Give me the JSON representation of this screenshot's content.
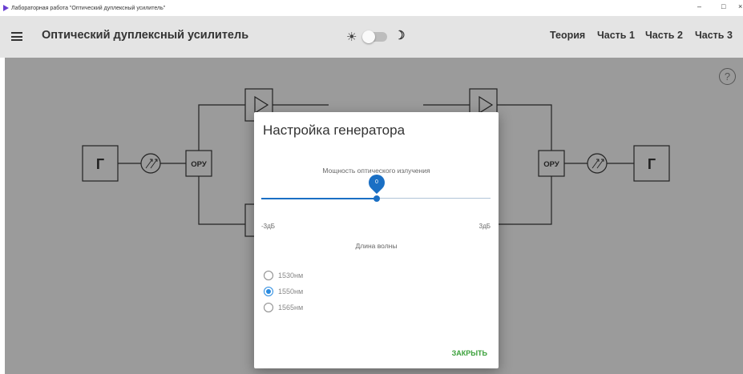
{
  "window": {
    "title": "Лабораторная работа \"Оптический дуплексный усилитель\"",
    "controls": {
      "minimize": "–",
      "maximize": "□",
      "close": "×"
    }
  },
  "appbar": {
    "menu_icon": "hamburger-menu-icon",
    "title": "Оптический дуплексный усилитель",
    "theme": {
      "sun_icon": "☀",
      "moon_icon": "☽",
      "dark_mode": false
    },
    "nav": [
      "Теория",
      "Часть 1",
      "Часть 2",
      "Часть 3"
    ]
  },
  "diagram": {
    "left_generator": "Г",
    "left_oru": "ОРУ",
    "right_oru": "ОРУ",
    "right_generator": "Г"
  },
  "help_icon": "?",
  "dialog": {
    "title": "Настройка генератора",
    "power_label": "Мощность оптического излучения",
    "slider": {
      "value": "0",
      "min_label": "-3дБ",
      "max_label": "3дБ",
      "fraction": 0.5
    },
    "wavelength_label": "Длина волны",
    "options": [
      {
        "label": "1530нм",
        "checked": false
      },
      {
        "label": "1550нм",
        "checked": true
      },
      {
        "label": "1565нм",
        "checked": false
      }
    ],
    "close_label": "ЗАКРЫТЬ"
  },
  "colors": {
    "appbar": "#e4e4e4",
    "background": "#9b9b9b",
    "accent": "#1a6fc4",
    "close": "#3aa03a"
  }
}
